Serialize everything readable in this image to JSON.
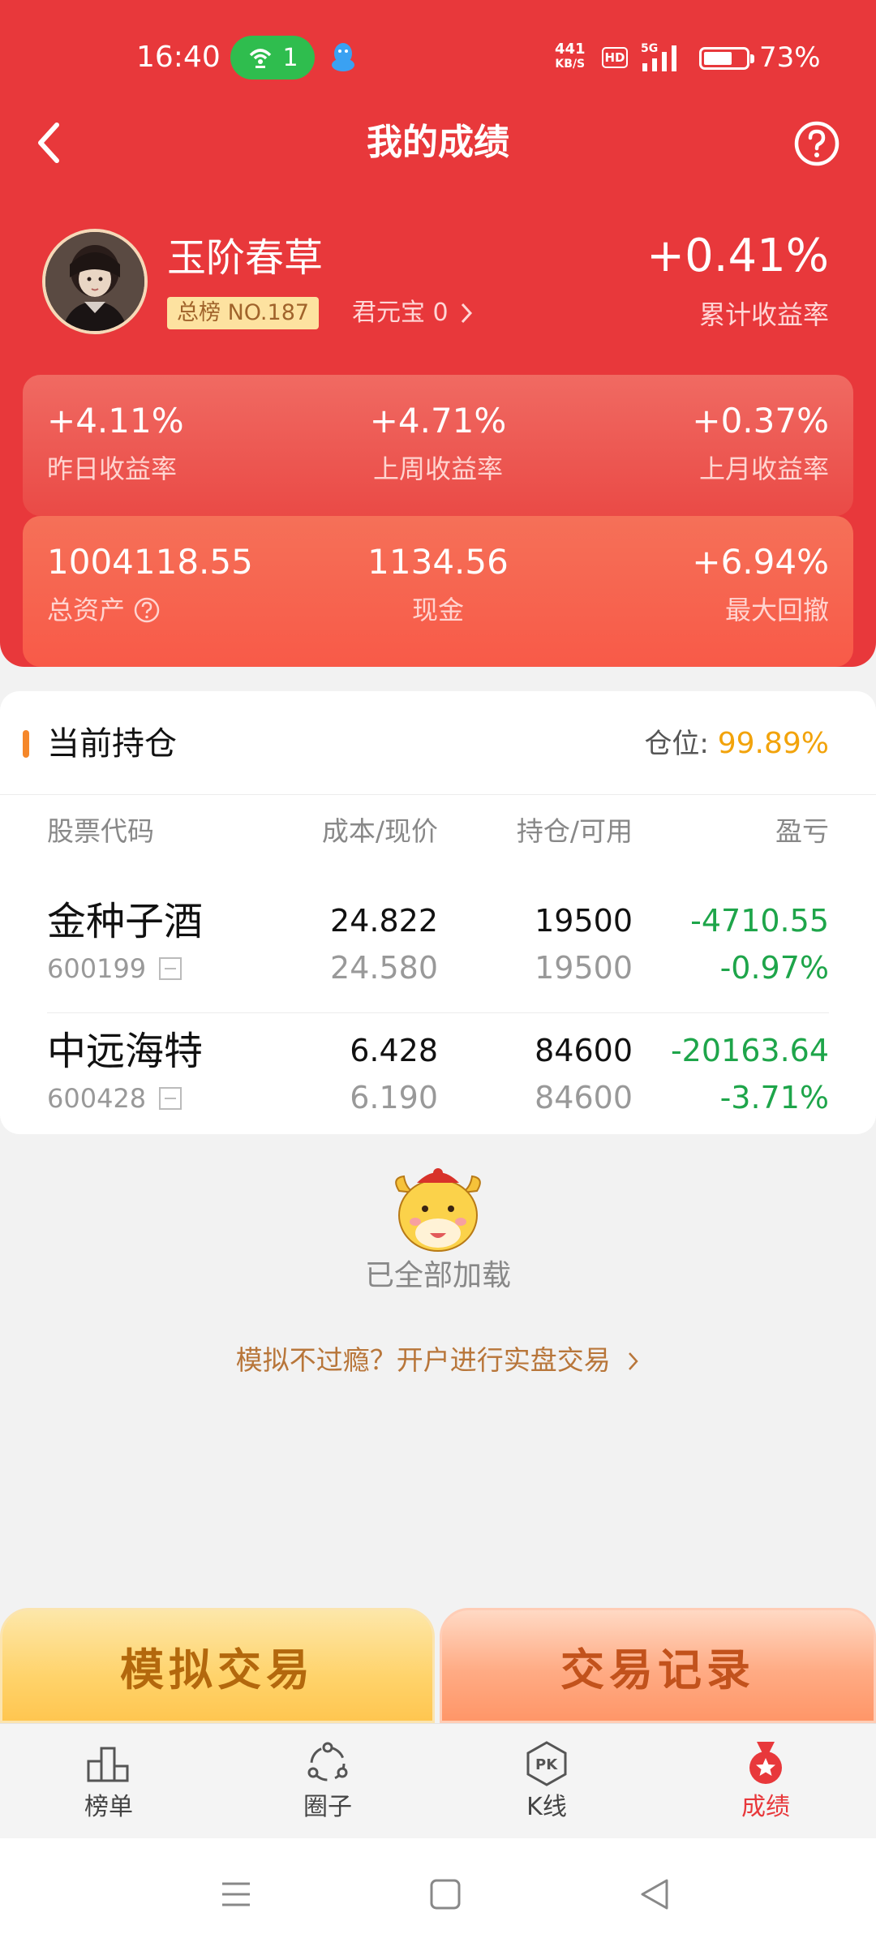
{
  "status_bar": {
    "time": "16:40",
    "hotspot_count": "1",
    "net_speed_value": "441",
    "net_speed_unit": "KB/S",
    "hd": "HD",
    "network": "5G",
    "battery_percent": "73%",
    "battery_level": 0.73
  },
  "nav": {
    "title": "我的成绩",
    "back_icon": "chevron-left-icon",
    "help_icon": "question-circle-icon"
  },
  "profile": {
    "username": "玉阶春草",
    "rank_badge": "总榜 NO.187",
    "coin_text": "君元宝 0",
    "total_return": "+0.41%",
    "total_return_label": "累计收益率"
  },
  "stats_row_1": [
    {
      "value": "+4.11%",
      "label": "昨日收益率"
    },
    {
      "value": "+4.71%",
      "label": "上周收益率"
    },
    {
      "value": "+0.37%",
      "label": "上月收益率"
    }
  ],
  "stats_row_2": [
    {
      "value": "1004118.55",
      "label": "总资产"
    },
    {
      "value": "1134.56",
      "label": "现金"
    },
    {
      "value": "+6.94%",
      "label": "最大回撤"
    }
  ],
  "holdings": {
    "title": "当前持仓",
    "position_label": "仓位:",
    "position_value": "99.89%",
    "columns": [
      "股票代码",
      "成本/现价",
      "持仓/可用",
      "盈亏"
    ],
    "rows": [
      {
        "name": "金种子酒",
        "code": "600199",
        "cost": "24.822",
        "price": "24.580",
        "holding": "19500",
        "available": "19500",
        "pnl": "-4710.55",
        "pnl_pct": "-0.97%"
      },
      {
        "name": "中远海特",
        "code": "600428",
        "cost": "6.428",
        "price": "6.190",
        "holding": "84600",
        "available": "84600",
        "pnl": "-20163.64",
        "pnl_pct": "-3.71%"
      }
    ]
  },
  "footer": {
    "loaded_text": "已全部加载",
    "promo_text": "模拟不过瘾？开户进行实盘交易",
    "btn_simulate": "模拟交易",
    "btn_records": "交易记录"
  },
  "tabs": [
    {
      "label": "榜单",
      "icon": "leaderboard-icon"
    },
    {
      "label": "圈子",
      "icon": "community-icon"
    },
    {
      "label": "K线",
      "icon": "pk-kline-icon"
    },
    {
      "label": "成绩",
      "icon": "medal-icon",
      "active": true
    }
  ],
  "colors": {
    "header_red": "#e8383b",
    "loss_green": "#1ea54a",
    "position_orange": "#f2a30b",
    "active_tab": "#e8383b"
  }
}
